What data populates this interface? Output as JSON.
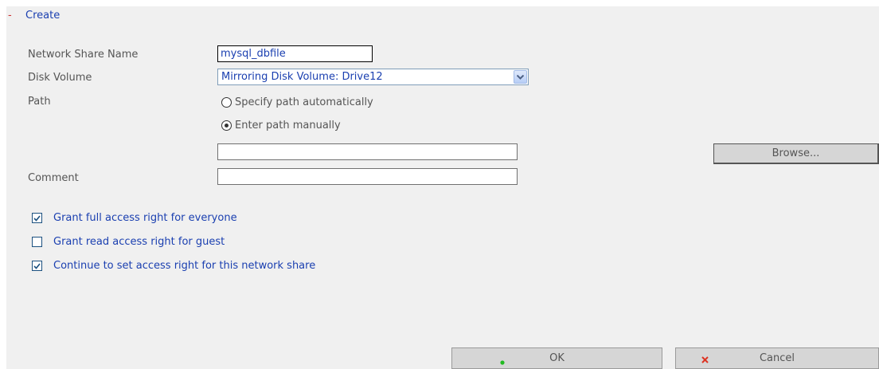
{
  "section": {
    "collapse_symbol": "-",
    "title": "Create"
  },
  "form": {
    "share_name_label": "Network Share Name",
    "share_name_value": "mysql_dbfile",
    "disk_volume_label": "Disk Volume",
    "disk_volume_value": "Mirroring Disk Volume: Drive12",
    "path_label": "Path",
    "path_auto_label": "Specify path automatically",
    "path_manual_label": "Enter path manually",
    "path_selected": "manual",
    "path_value": "",
    "browse_label": "Browse...",
    "comment_label": "Comment",
    "comment_value": ""
  },
  "permissions": [
    {
      "label": "Grant full access right for everyone",
      "checked": true
    },
    {
      "label": "Grant read access right for guest",
      "checked": false
    },
    {
      "label": "Continue to set access right for this network share",
      "checked": true
    }
  ],
  "actions": {
    "ok_label": "OK",
    "cancel_label": "Cancel"
  },
  "colors": {
    "accent_text": "#1a3fb0",
    "collapse": "#cc3333",
    "ok_icon": "#22bb22",
    "cancel_icon": "#dd3322"
  }
}
